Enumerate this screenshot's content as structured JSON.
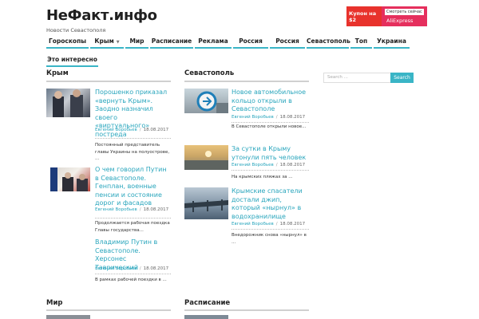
{
  "site": {
    "title": "НеФакт.инфо",
    "tagline": "Новости Севастополя"
  },
  "banner": {
    "promo": "Купон на $2",
    "cta": "Смотреть сейчас",
    "brand": "AliExpress"
  },
  "nav": {
    "items": [
      "Гороскопы",
      "Крым",
      "Мир",
      "Расписание",
      "Реклама",
      "Россия",
      "Россия",
      "Севастополь",
      "Топ",
      "Украина",
      "Это интересно"
    ],
    "dropdown_icon": "caret-down-icon"
  },
  "sections": {
    "krym": {
      "title": "Крым",
      "articles": [
        {
          "title": "Порошенко приказал «вернуть Крым». Заодно назначил своего «виртуального» постреда",
          "author": "Евгений Воробьев",
          "date": "18.08.2017",
          "excerpt": "Постоянный представитель главы Украины на полуострове, ..."
        },
        {
          "title": "О чем говорил Путин в Севастополе. Генплан, военные пенсии и состояние дорог и фасадов",
          "author": "Евгений Воробьев",
          "date": "18.08.2017",
          "excerpt": "Продолжается рабочая поездка Главы государства..."
        },
        {
          "title": "Владимир Путин в Севастополе. Херсонес Таврический",
          "author": "Евгений Воробьев",
          "date": "18.08.2017",
          "excerpt": "В рамках рабочей поездки в ..."
        }
      ]
    },
    "sevastopol": {
      "title": "Севастополь",
      "articles": [
        {
          "title": "Новое автомобильное кольцо открыли в Севастополе",
          "author": "Евгений Воробьев",
          "date": "18.08.2017",
          "excerpt": "В Севастополе открыли новое..."
        },
        {
          "title": "За сутки в Крыму утонули пять человек",
          "author": "Евгений Воробьев",
          "date": "18.08.2017",
          "excerpt": "На крымских пляжах за ..."
        },
        {
          "title": "Крымские спасатели достали джип, который «нырнул» в водохранилище",
          "author": "Евгений Воробьев",
          "date": "18.08.2017",
          "excerpt": "Внедорожник снова «нырнул» в ..."
        }
      ]
    },
    "mir": {
      "title": "Мир"
    },
    "raspisanie": {
      "title": "Расписание"
    }
  },
  "search": {
    "placeholder": "Search ...",
    "button": "Search"
  }
}
